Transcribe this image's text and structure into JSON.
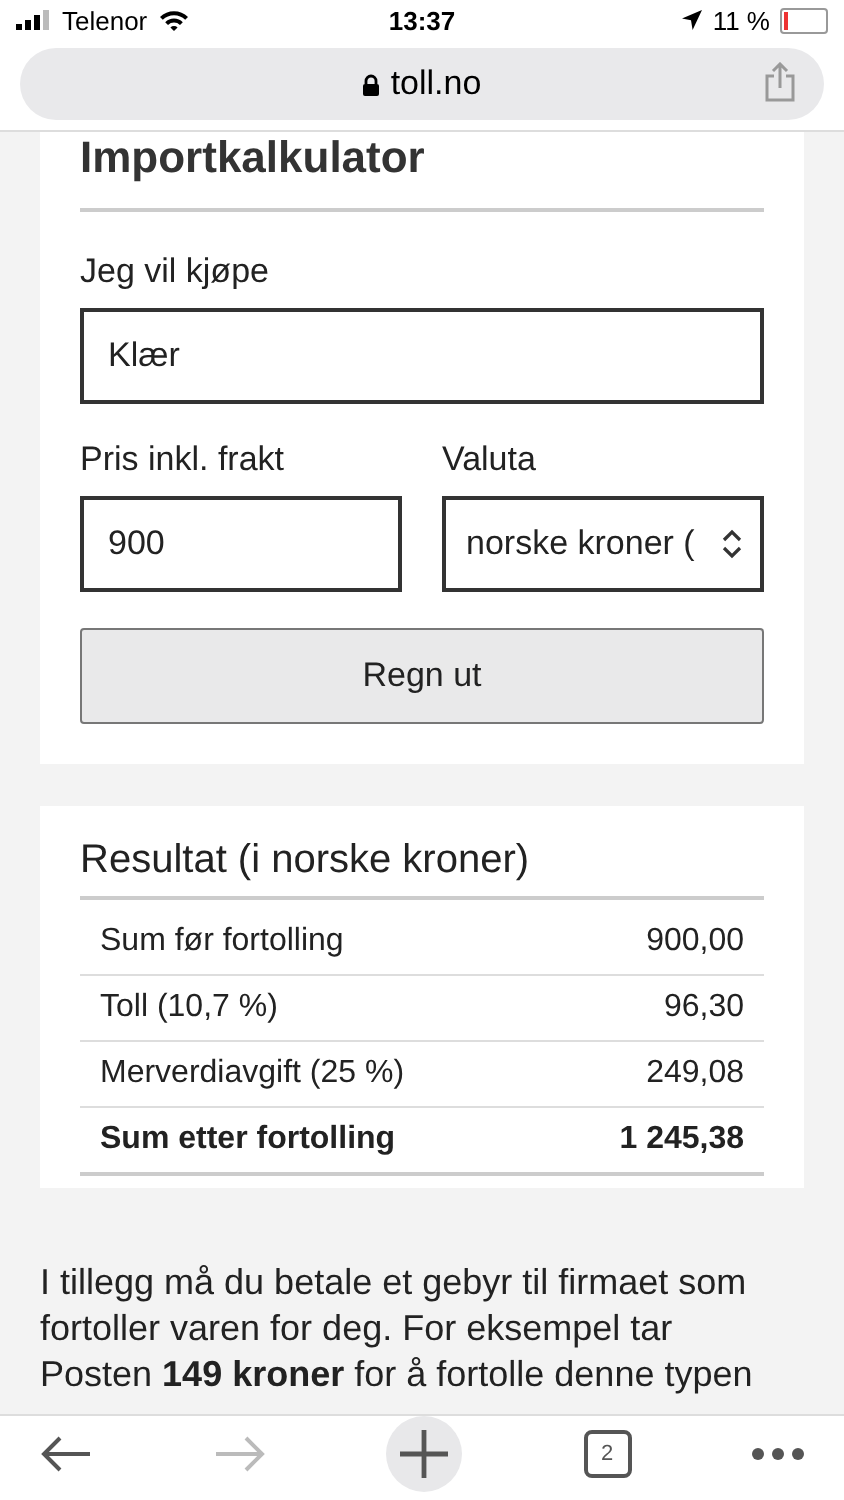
{
  "status_bar": {
    "carrier": "Telenor",
    "time": "13:37",
    "battery": "11 %"
  },
  "address_bar": {
    "url": "toll.no"
  },
  "calculator": {
    "title": "Importkalkulator",
    "fields": [
      {
        "label": "Jeg vil kjøpe",
        "value": "Klær",
        "kind": "text"
      },
      {
        "label": "Pris inkl. frakt",
        "value": "900",
        "kind": "text"
      },
      {
        "label": "Valuta",
        "value": "norske kroner (",
        "kind": "select"
      }
    ],
    "button": "Regn ut"
  },
  "result": {
    "title": "Resultat (i norske kroner)",
    "rows": [
      {
        "label": "Sum før fortolling",
        "value": "900,00",
        "bold": false
      },
      {
        "label": "Toll (10,7 %)",
        "value": "96,30",
        "bold": false
      },
      {
        "label": "Merverdiavgift (25 %)",
        "value": "249,08",
        "bold": false
      },
      {
        "label": "Sum etter fortolling",
        "value": "1 245,38",
        "bold": true
      }
    ]
  },
  "note": "I tillegg må du betale et gebyr til firmaet som fortoller varen for deg. For eksempel tar Posten **149 kroner** for å fortolle denne typen",
  "toolbar": {
    "tab_count": "2"
  }
}
